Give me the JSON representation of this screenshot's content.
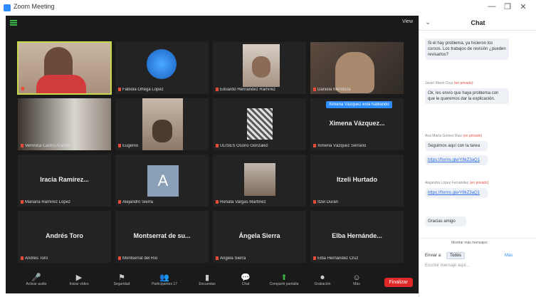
{
  "window": {
    "title": "Zoom Meeting",
    "controls": [
      "—",
      "❐",
      "✕"
    ]
  },
  "meeting": {
    "view_button": "View",
    "tiles": [
      {
        "name": "",
        "center": "",
        "kind": "video-woman-glasses",
        "active": true
      },
      {
        "name": "Fabiola Ortega López",
        "center": "",
        "kind": "avatar-blue"
      },
      {
        "name": "Eduardo Hernández Ramírez",
        "center": "",
        "kind": "video-man"
      },
      {
        "name": "Daniela Mendoza",
        "center": "",
        "kind": "video-woman"
      },
      {
        "name": "Veronica Castro Aranda",
        "center": "",
        "kind": "video-bright"
      },
      {
        "name": "Eugenio",
        "center": "",
        "kind": "video-person"
      },
      {
        "name": "ULISES Osorio Gonzalez",
        "center": "",
        "kind": "photo-bw"
      },
      {
        "name": "Ximena Vázquez Serrano",
        "center": "Ximena Vázquez...",
        "kind": "text"
      },
      {
        "name": "Mariana Ramírez López",
        "center": "Iracia Ramírez...",
        "kind": "text"
      },
      {
        "name": "Alejandro Sierra",
        "center": "",
        "kind": "avatar-letter",
        "letter": "A"
      },
      {
        "name": "Renata Vargas Martínez",
        "center": "",
        "kind": "photo-color"
      },
      {
        "name": "Itzel Duran",
        "center": "Itzeli Hurtado",
        "kind": "text"
      },
      {
        "name": "Andrés Toro",
        "center": "Andrés Toro",
        "kind": "text"
      },
      {
        "name": "Montserrat del Río",
        "center": "Montserrat de su...",
        "kind": "text"
      },
      {
        "name": "Ángela Sierra",
        "center": "Ángela Sierra",
        "kind": "text"
      },
      {
        "name": "Elba Hernández Cruz",
        "center": "Elba Hernánde...",
        "kind": "text"
      }
    ],
    "tooltip": "Ximena Vázquez está hablando"
  },
  "toolbar": {
    "buttons": [
      {
        "icon": "🎤",
        "label": "Activar audio"
      },
      {
        "icon": "▶",
        "label": "Iniciar vídeo"
      },
      {
        "icon": "⚑",
        "label": "Seguridad"
      },
      {
        "icon": "👥",
        "label": "Participantes 17"
      },
      {
        "icon": "▮",
        "label": "Encuestas"
      },
      {
        "icon": "💬",
        "label": "Chat"
      },
      {
        "icon": "⬆",
        "label": "Compartir pantalla"
      },
      {
        "icon": "⏺",
        "label": "Grabación"
      },
      {
        "icon": "☺",
        "label": "Más"
      }
    ],
    "end_label": "Finalizar"
  },
  "chat": {
    "title": "Chat",
    "messages": [
      {
        "meta": "",
        "private": "",
        "text": "Si él hay problema, ya hicieron los cursos. Los trabajos de revisión ¿pueden revisarlos?"
      },
      {
        "meta": "Javier Marín Cruz",
        "private": "(en privado)",
        "text": "Ok, les envío que haya problema con que le queremos dar la explicación."
      },
      {
        "meta": "Ana María Gómez Ruiz",
        "private": "(en privado)",
        "text": "Seguimos aquí con la tarea"
      },
      {
        "meta": "",
        "private": "",
        "text": "https://forms.gle/Y8kZ3aQ1",
        "link": true
      },
      {
        "meta": "Alejandra López Fernández",
        "private": "(en privado)",
        "text": "https://forms.gle/Y8kZ3aQ1",
        "link": true
      },
      {
        "meta": "",
        "private": "",
        "text": "Gracias amigo"
      }
    ],
    "more_label": "Mostrar más mensajes",
    "to_label": "Enviar a:",
    "to_value": "Todos",
    "file_label": "Más",
    "input_placeholder": "Escribir mensaje aquí..."
  }
}
